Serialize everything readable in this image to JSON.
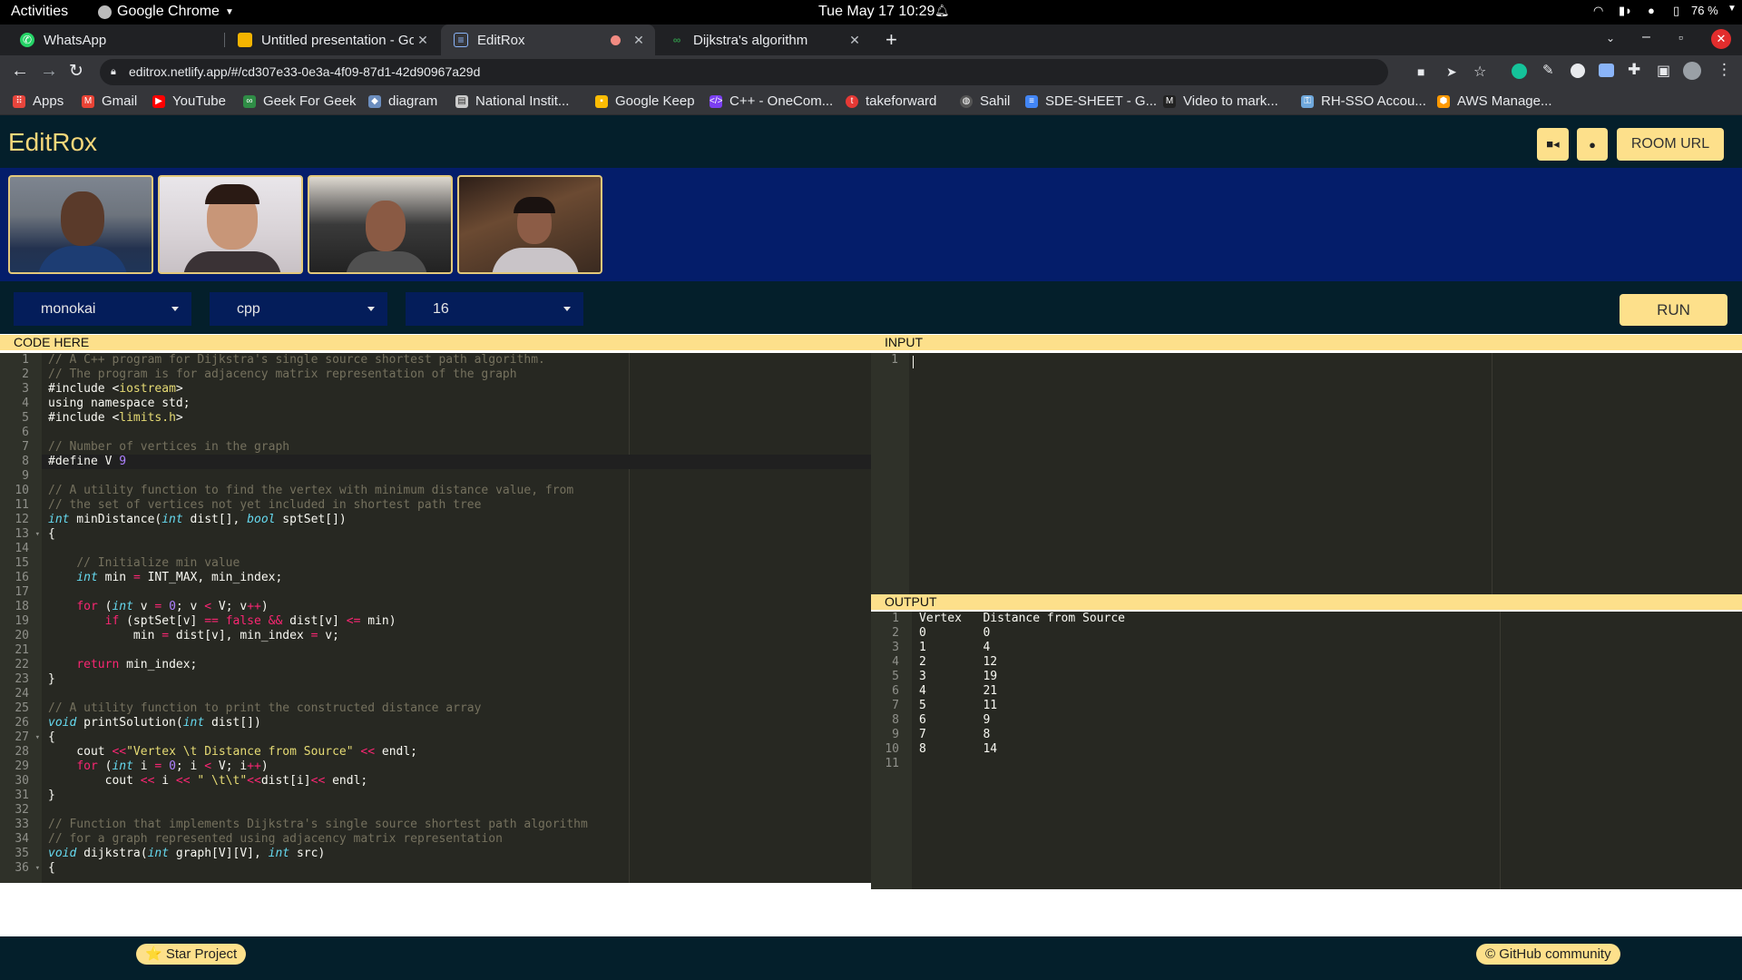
{
  "system_bar": {
    "activities": "Activities",
    "app_name": "Google Chrome",
    "clock": "Tue May 17  10:29",
    "battery": "76 %"
  },
  "tabs": [
    {
      "title": "WhatsApp",
      "icon": "whatsapp-icon",
      "active": false
    },
    {
      "title": "Untitled presentation - Go",
      "icon": "slides-icon",
      "active": false
    },
    {
      "title": "EditRox",
      "icon": "editrox-icon",
      "active": true
    },
    {
      "title": "Dijkstra's algorithm",
      "icon": "gfg-icon",
      "active": false
    }
  ],
  "address_bar": {
    "url": "editrox.netlify.app/#/cd307e33-0e3a-4f09-87d1-42d90967a29d"
  },
  "bookmarks": [
    {
      "label": "Apps",
      "icon": "apps-grid-icon",
      "color": "#e8453c"
    },
    {
      "label": "Gmail",
      "icon": "gmail-icon",
      "color": "#ea4335"
    },
    {
      "label": "YouTube",
      "icon": "youtube-icon",
      "color": "#ff0000"
    },
    {
      "label": "Geek For Geek",
      "icon": "gfg-icon",
      "color": "#2f8d46"
    },
    {
      "label": "diagram",
      "icon": "diagram-icon",
      "color": "#6c8ebf"
    },
    {
      "label": "National Instit...",
      "icon": "bookmark-icon",
      "color": "#cccccc"
    },
    {
      "label": "Google Keep",
      "icon": "keep-icon",
      "color": "#fbbc04"
    },
    {
      "label": "C++ - OneCom...",
      "icon": "code-icon",
      "color": "#7b3ff2"
    },
    {
      "label": "takeforward",
      "icon": "takeforward-icon",
      "color": "#e53935"
    },
    {
      "label": "Sahil",
      "icon": "globe-icon",
      "color": "#555555"
    },
    {
      "label": "SDE-SHEET - G...",
      "icon": "docs-icon",
      "color": "#4285f4"
    },
    {
      "label": "Video to mark...",
      "icon": "medium-icon",
      "color": "#222222"
    },
    {
      "label": "RH-SSO Accou...",
      "icon": "redhat-icon",
      "color": "#6fa8dc"
    },
    {
      "label": "AWS Manage...",
      "icon": "aws-icon",
      "color": "#ff9900"
    }
  ],
  "app": {
    "brand": "EditRox",
    "room_url_label": "ROOM URL",
    "run_label": "RUN",
    "theme": "monokai",
    "language": "cpp",
    "font_size": "16",
    "code_header": "CODE HERE",
    "input_header": "INPUT",
    "output_header": "OUTPUT",
    "accent_color": "#fde08b",
    "header_bg": "#041f2b",
    "video_strip_bg": "#041d6a",
    "participants": [
      "participant-1",
      "participant-2",
      "participant-3",
      "participant-4"
    ]
  },
  "code_lines": [
    "// A C++ program for Dijkstra's single source shortest path algorithm.",
    "// The program is for adjacency matrix representation of the graph",
    "#include <iostream>",
    "using namespace std;",
    "#include <limits.h>",
    "",
    "// Number of vertices in the graph",
    "#define V 9",
    "",
    "// A utility function to find the vertex with minimum distance value, from",
    "// the set of vertices not yet included in shortest path tree",
    "int minDistance(int dist[], bool sptSet[])",
    "{",
    "",
    "    // Initialize min value",
    "    int min = INT_MAX, min_index;",
    "",
    "    for (int v = 0; v < V; v++)",
    "        if (sptSet[v] == false && dist[v] <= min)",
    "            min = dist[v], min_index = v;",
    "",
    "    return min_index;",
    "}",
    "",
    "// A utility function to print the constructed distance array",
    "void printSolution(int dist[])",
    "{",
    "    cout <<\"Vertex \\t Distance from Source\" << endl;",
    "    for (int i = 0; i < V; i++)",
    "        cout << i << \" \\t\\t\"<<dist[i]<< endl;",
    "}",
    "",
    "// Function that implements Dijkstra's single source shortest path algorithm",
    "// for a graph represented using adjacency matrix representation",
    "void dijkstra(int graph[V][V], int src)",
    "{"
  ],
  "input_lines": [
    ""
  ],
  "output_lines": [
    "Vertex   Distance from Source",
    "0        0",
    "1        4",
    "2        12",
    "3        19",
    "4        21",
    "5        11",
    "6        9",
    "7        8",
    "8        14",
    ""
  ],
  "footer": {
    "star_label": "⭐ Star Project",
    "github_label": "© GitHub community"
  }
}
